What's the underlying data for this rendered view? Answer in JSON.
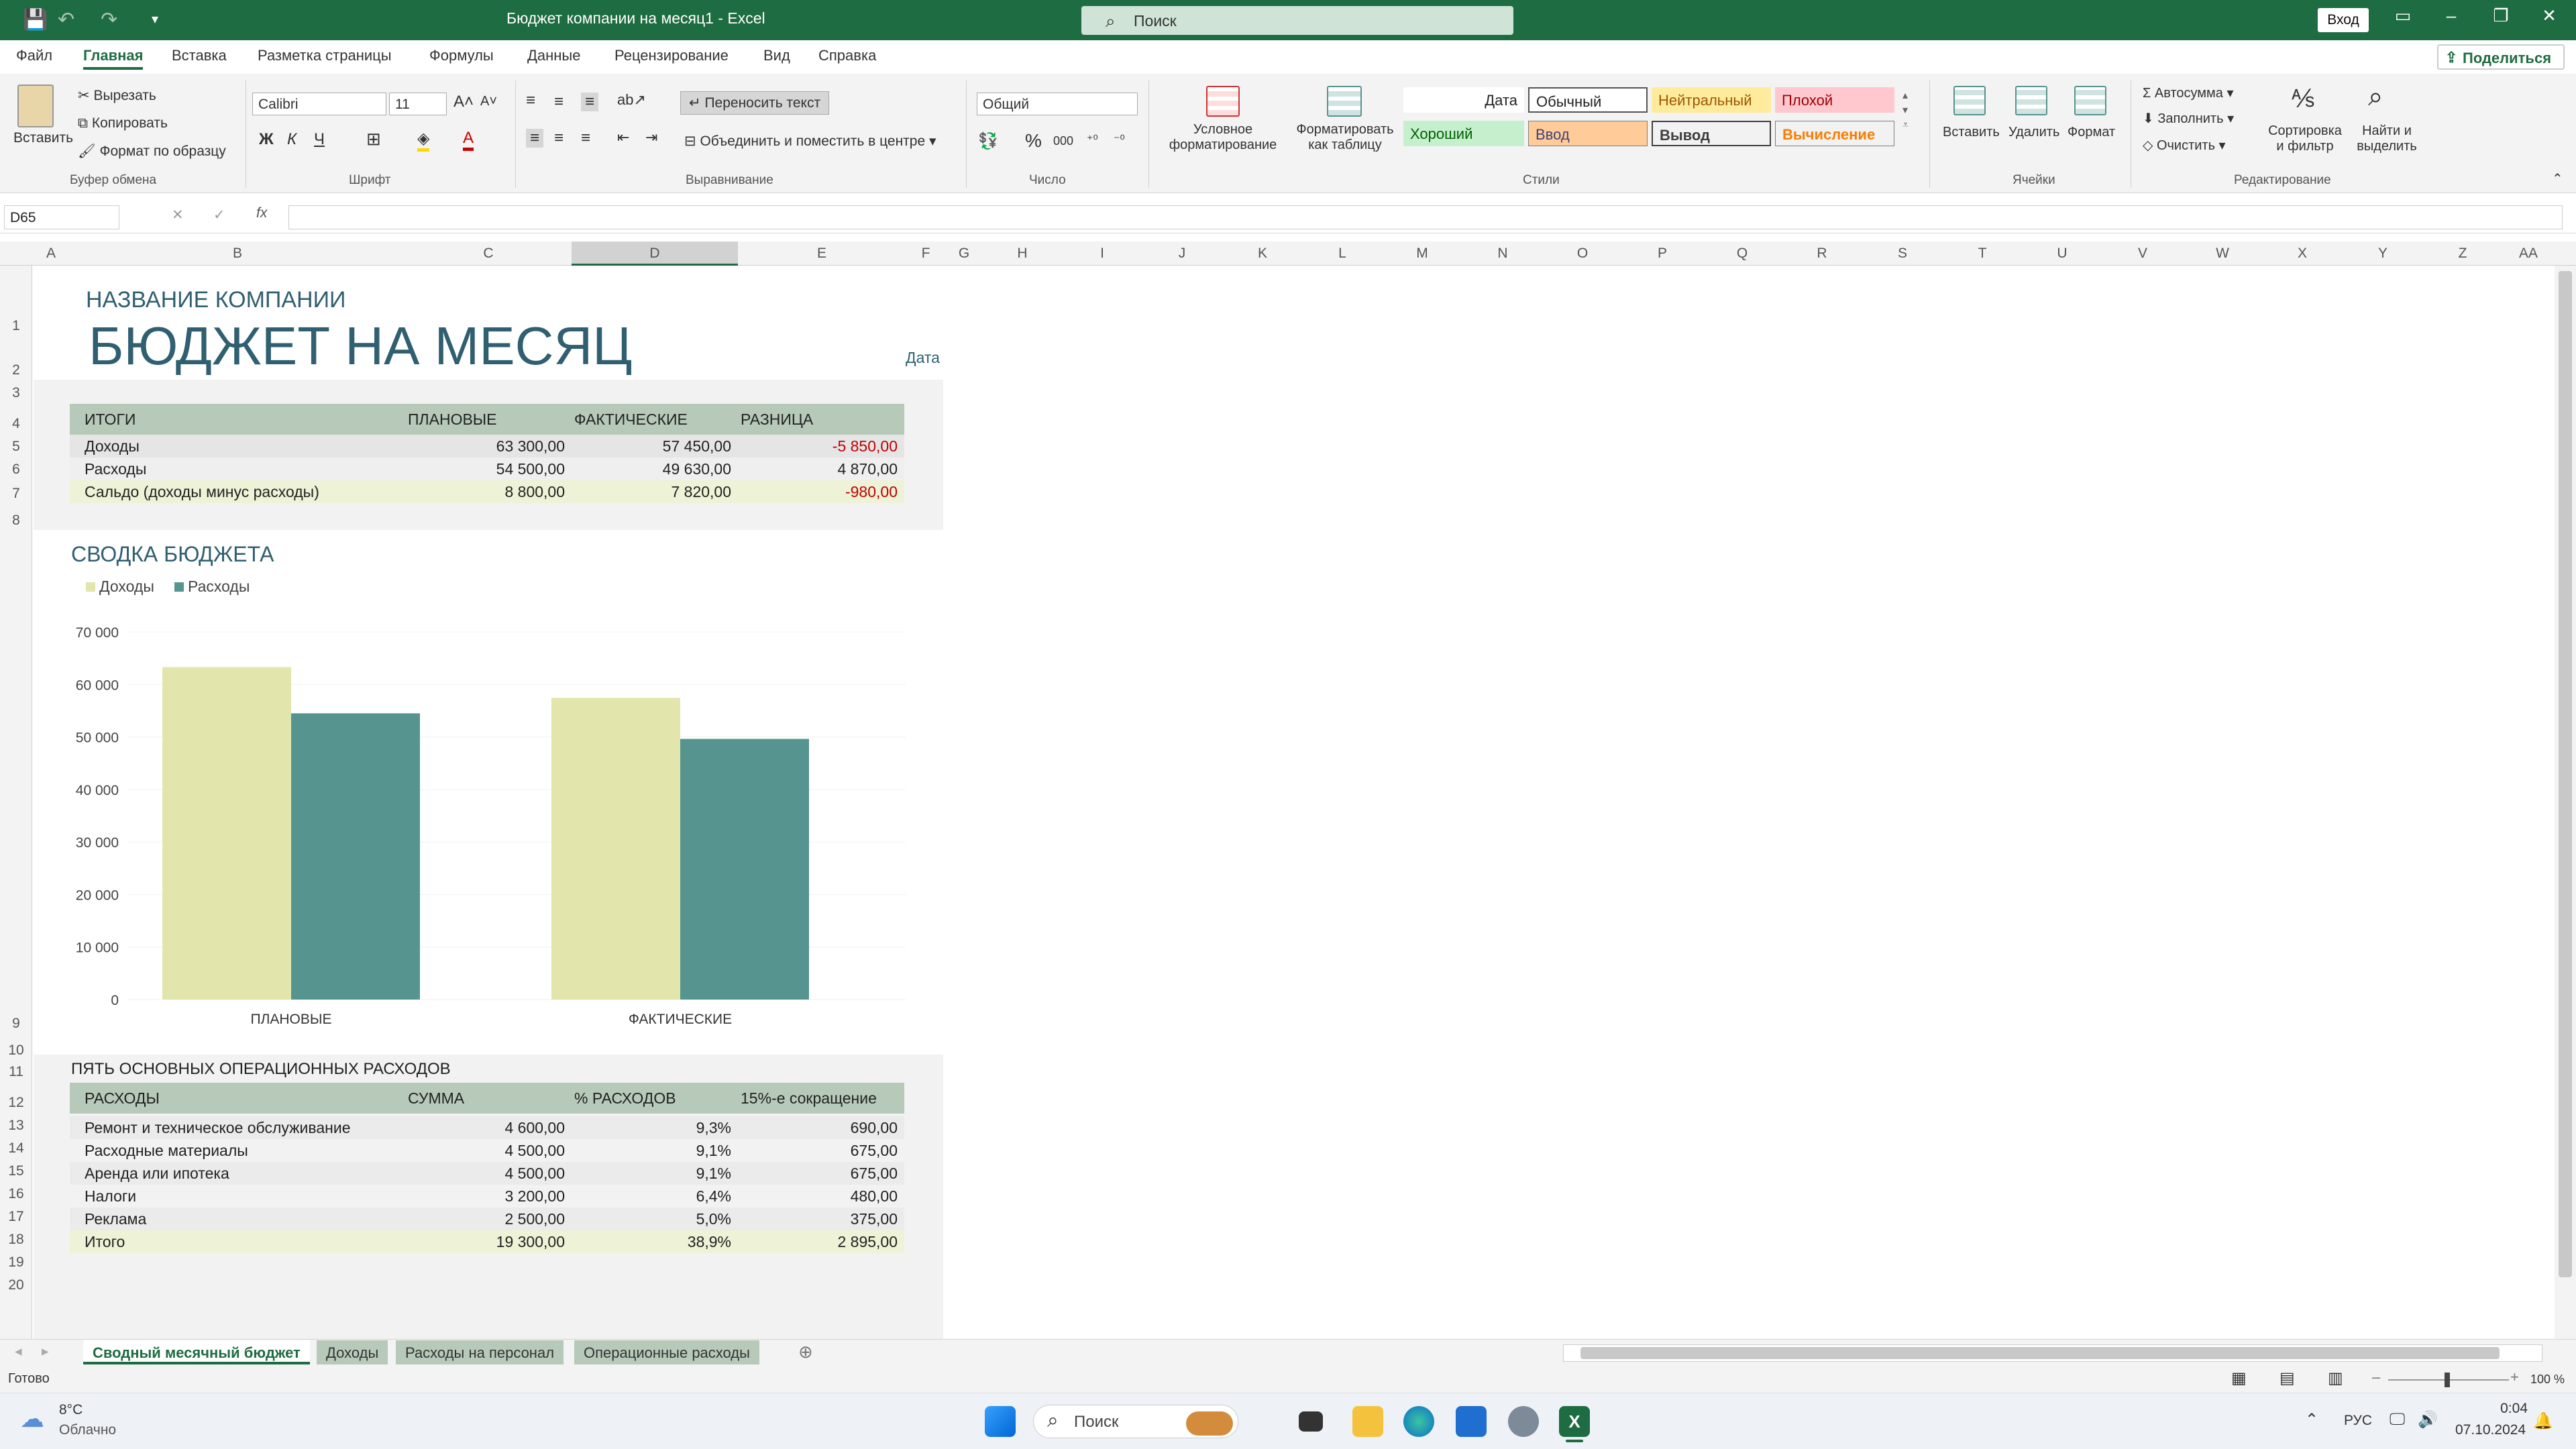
{
  "window": {
    "title": "Бюджет компании на месяц1 - Excel",
    "search_placeholder": "Поиск",
    "signin": "Вход"
  },
  "menu": {
    "tabs": [
      "Файл",
      "Главная",
      "Вставка",
      "Разметка страницы",
      "Формулы",
      "Данные",
      "Рецензирование",
      "Вид",
      "Справка"
    ],
    "active": "Главная",
    "share": "Поделиться"
  },
  "ribbon": {
    "clipboard": {
      "paste": "Вставить",
      "cut": "Вырезать",
      "copy": "Копировать",
      "format_painter": "Формат по образцу",
      "label": "Буфер обмена"
    },
    "font": {
      "name": "Calibri",
      "size": "11",
      "label": "Шрифт",
      "bold": "Ж",
      "italic": "К",
      "underline": "Ч"
    },
    "alignment": {
      "wrap": "Переносить текст",
      "merge": "Объединить и поместить в центре",
      "label": "Выравнивание"
    },
    "number": {
      "format": "Общий",
      "label": "Число"
    },
    "styles": {
      "cond_format": "Условное форматирование",
      "format_table": "Форматировать как таблицу",
      "cells": [
        "Дата",
        "Обычный",
        "Нейтральный",
        "Плохой",
        "Хороший",
        "Ввод",
        "Вывод",
        "Вычисление"
      ],
      "label": "Стили"
    },
    "cells": {
      "insert": "Вставить",
      "delete": "Удалить",
      "format": "Формат",
      "label": "Ячейки"
    },
    "editing": {
      "autosum": "Автосумма",
      "fill": "Заполнить",
      "clear": "Очистить",
      "sort": "Сортировка и фильтр",
      "find": "Найти и выделить",
      "label": "Редактирование"
    }
  },
  "formula_bar": {
    "namebox": "D65",
    "formula": ""
  },
  "columns": [
    "A",
    "B",
    "C",
    "D",
    "E",
    "F",
    "G",
    "H",
    "I",
    "J",
    "K",
    "L",
    "M",
    "N",
    "O",
    "P",
    "Q",
    "R",
    "S",
    "T",
    "U",
    "V",
    "W",
    "X",
    "Y",
    "Z",
    "AA"
  ],
  "rows": [
    "1",
    "2",
    "3",
    "4",
    "5",
    "6",
    "7",
    "8",
    "9",
    "10",
    "11",
    "12",
    "13",
    "14",
    "15",
    "16",
    "17",
    "18",
    "19",
    "20"
  ],
  "sheet": {
    "company": "НАЗВАНИЕ КОМПАНИИ",
    "title": "БЮДЖЕТ НА МЕСЯЦ",
    "date_label": "Дата",
    "summary": {
      "headers": [
        "ИТОГИ",
        "ПЛАНОВЫЕ",
        "ФАКТИЧЕСКИЕ",
        "РАЗНИЦА"
      ],
      "rows": [
        [
          "Доходы",
          "63 300,00",
          "57 450,00",
          "-5 850,00"
        ],
        [
          "Расходы",
          "54 500,00",
          "49 630,00",
          "4 870,00"
        ],
        [
          "Сальдо (доходы минус расходы)",
          "8 800,00",
          "7 820,00",
          "-980,00"
        ]
      ]
    },
    "chart_title": "СВОДКА БЮДЖЕТА",
    "top5_title": "ПЯТЬ ОСНОВНЫХ ОПЕРАЦИОННЫХ РАСХОДОВ",
    "top5": {
      "headers": [
        "РАСХОДЫ",
        "СУММА",
        "% РАСХОДОВ",
        "15%-е сокращение"
      ],
      "rows": [
        [
          "Ремонт и техническое обслуживание",
          "4 600,00",
          "9,3%",
          "690,00"
        ],
        [
          "Расходные материалы",
          "4 500,00",
          "9,1%",
          "675,00"
        ],
        [
          "Аренда или ипотека",
          "4 500,00",
          "9,1%",
          "675,00"
        ],
        [
          "Налоги",
          "3 200,00",
          "6,4%",
          "480,00"
        ],
        [
          "Реклама",
          "2 500,00",
          "5,0%",
          "375,00"
        ],
        [
          "Итого",
          "19 300,00",
          "38,9%",
          "2 895,00"
        ]
      ]
    }
  },
  "chart_data": {
    "type": "bar",
    "title": "СВОДКА БЮДЖЕТА",
    "categories": [
      "ПЛАНОВЫЕ",
      "ФАКТИЧЕСКИЕ"
    ],
    "series": [
      {
        "name": "Доходы",
        "values": [
          63300,
          57450
        ],
        "color": "#e2e6ad"
      },
      {
        "name": "Расходы",
        "values": [
          54500,
          49630
        ],
        "color": "#56948f"
      }
    ],
    "ylim": [
      0,
      70000
    ],
    "yticks": [
      "0",
      "10 000",
      "20 000",
      "30 000",
      "40 000",
      "50 000",
      "60 000",
      "70 000"
    ],
    "legend": "top-left"
  },
  "sheet_tabs": [
    "Сводный месячный бюджет",
    "Доходы",
    "Расходы на персонал",
    "Операционные расходы"
  ],
  "status": {
    "ready": "Готово",
    "zoom": "100 %"
  },
  "taskbar": {
    "weather_temp": "8°C",
    "weather_desc": "Облачно",
    "search": "Поиск",
    "lang": "РУС",
    "time": "0:04",
    "date": "07.10.2024"
  },
  "colors": {
    "excel_green": "#1e6c41",
    "table_header": "#b7c9b8",
    "negative": "#c00000"
  }
}
